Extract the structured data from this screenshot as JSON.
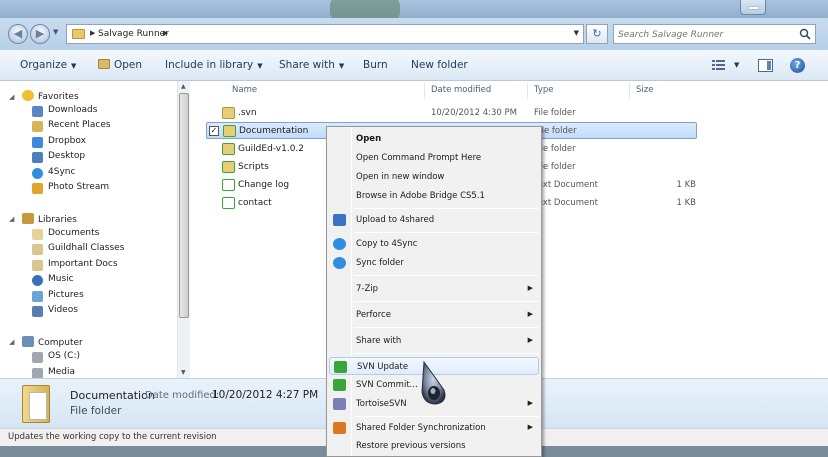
{
  "address": {
    "breadcrumb": "Salvage Runner",
    "search_placeholder": "Search Salvage Runner"
  },
  "toolbar": {
    "organize": "Organize",
    "open": "Open",
    "include_in_library": "Include in library",
    "share_with": "Share with",
    "burn": "Burn",
    "new_folder": "New folder"
  },
  "nav": {
    "favorites": {
      "label": "Favorites",
      "items": [
        "Downloads",
        "Recent Places",
        "Dropbox",
        "Desktop",
        "4Sync",
        "Photo Stream"
      ]
    },
    "libraries": {
      "label": "Libraries",
      "items": [
        "Documents",
        "Guildhall Classes",
        "Important Docs",
        "Music",
        "Pictures",
        "Videos"
      ]
    },
    "computer": {
      "label": "Computer",
      "items": [
        "OS (C:)",
        "Media"
      ]
    }
  },
  "columns": {
    "name": "Name",
    "date": "Date modified",
    "type": "Type",
    "size": "Size"
  },
  "files": [
    {
      "name": ".svn",
      "date": "10/20/2012 4:30 PM",
      "type": "File folder",
      "size": ""
    },
    {
      "name": "Documentation",
      "date": "",
      "type": "File folder",
      "size": ""
    },
    {
      "name": "GuildEd-v1.0.2",
      "date": "",
      "type": "File folder",
      "size": ""
    },
    {
      "name": "Scripts",
      "date": "",
      "type": "File folder",
      "size": ""
    },
    {
      "name": "Change log",
      "date": "",
      "type": "Text Document",
      "size": "1 KB"
    },
    {
      "name": "contact",
      "date": "",
      "type": "Text Document",
      "size": "1 KB"
    }
  ],
  "context_menu": [
    "Open",
    "Open Command Prompt Here",
    "Open in new window",
    "Browse in Adobe Bridge CS5.1",
    "Upload to 4shared",
    "Copy to 4Sync",
    "Sync folder",
    "7-Zip",
    "Perforce",
    "Share with",
    "SVN Update",
    "SVN Commit...",
    "TortoiseSVN",
    "Shared Folder Synchronization",
    "Restore previous versions"
  ],
  "details": {
    "name": "Documentation",
    "modified_label": "Date modified:",
    "modified_value": "10/20/2012 4:27 PM",
    "type": "File folder"
  },
  "status": "Updates the working copy to the current revision",
  "colors": {
    "toolbar_text": "#1e395b",
    "selection": "#c1dcfa",
    "menu_bg": "#f1f1f1",
    "svn_green": "#3aa53a"
  }
}
